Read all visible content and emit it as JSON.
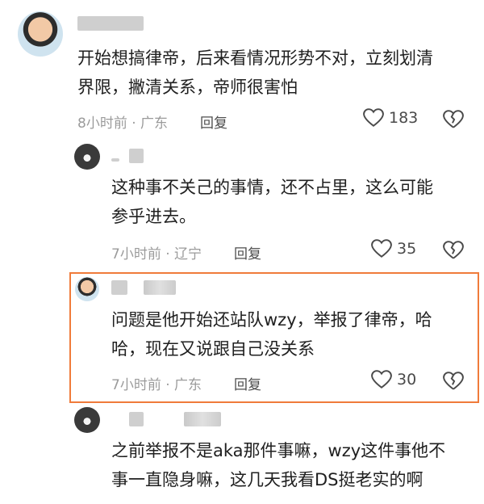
{
  "comments": [
    {
      "text": "开始想搞律帝，后来看情况形势不对，立刻划清\n界限，撇清关系，帝师很害怕",
      "time_location": "8小时前 · 广东",
      "reply_label": "回复",
      "likes": "183"
    },
    {
      "text": "这种事不关己的事情，还不占里，这么可能\n参乎进去。",
      "time_location": "7小时前 · 辽宁",
      "reply_label": "回复",
      "likes": "35"
    },
    {
      "text": "问题是他开始还站队wzy，举报了律帝，哈\n哈，现在又说跟自己没关系",
      "time_location": "7小时前 · 广东",
      "reply_label": "回复",
      "likes": "30"
    },
    {
      "text": "之前举报不是aka那件事嘛，wzy这件事他不\n事一直隐身嘛，这几天我看DS挺老实的啊"
    }
  ],
  "colors": {
    "highlight": "#f07b3a"
  }
}
